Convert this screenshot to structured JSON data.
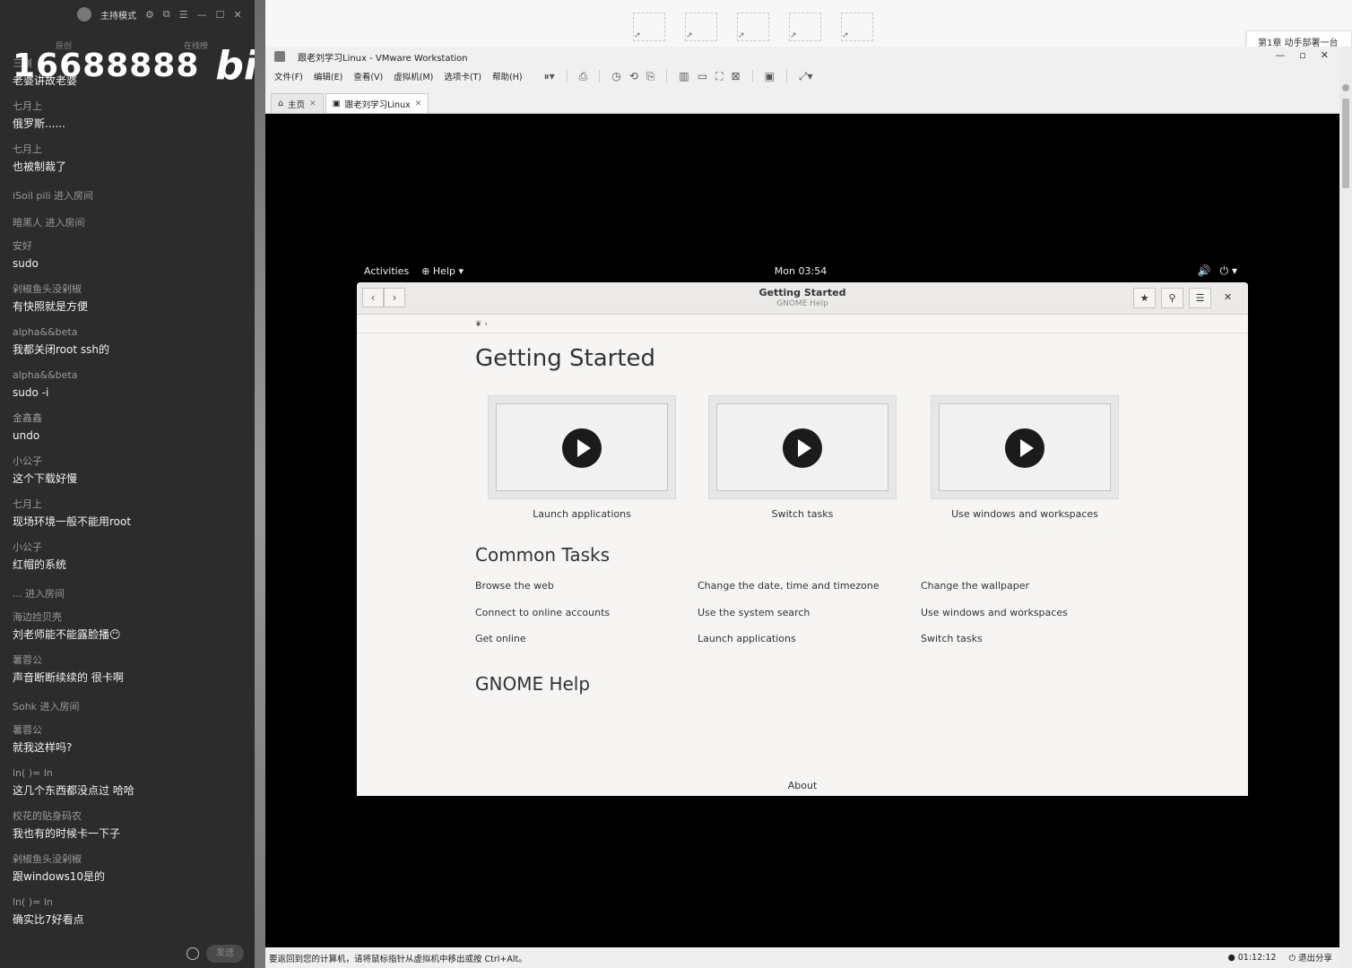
{
  "chat": {
    "header": {
      "mode": "主持模式"
    },
    "subheader": {
      "left": "原创",
      "right": "在线榜"
    },
    "brand": {
      "number": "16688888",
      "logo": "bili"
    },
    "messages": [
      {
        "user": "三崩",
        "text": "老婆讲故老婆"
      },
      {
        "user": "七月上",
        "text": "俄罗斯......"
      },
      {
        "user": "七月上",
        "text": "也被制裁了"
      },
      {
        "enter": "iSoil pili 进入房间"
      },
      {
        "enter": "暗黑人 进入房间"
      },
      {
        "user": "安好",
        "text": "sudo"
      },
      {
        "user": "剁椒鱼头没剁椒",
        "text": "有快照就是方便"
      },
      {
        "user": "alpha&&beta",
        "text": "我都关闭root ssh的"
      },
      {
        "user": "alpha&&beta",
        "text": "sudo -i"
      },
      {
        "user": "金鑫鑫",
        "text": "undo"
      },
      {
        "user": "小公子",
        "text": "这个下载好慢"
      },
      {
        "user": "七月上",
        "text": "现场环境一般不能用root"
      },
      {
        "user": "小公子",
        "text": "红帽的系统"
      },
      {
        "enter": "... 进入房间"
      },
      {
        "user": "海边捡贝壳",
        "text": "刘老师能不能露脸播😶"
      },
      {
        "user": "薯蓉公",
        "text": "声音断断续续的 很卡啊"
      },
      {
        "enter": "Sohk 进入房间"
      },
      {
        "user": "薯蓉公",
        "text": "就我这样吗?"
      },
      {
        "user": "ln( )= ln",
        "text": "这几个东西都没点过 哈哈"
      },
      {
        "user": "校花的贴身码农",
        "text": "我也有的时候卡一下子"
      },
      {
        "user": "剁椒鱼头没剁椒",
        "text": "跟windows10是的"
      },
      {
        "user": "ln( )= ln",
        "text": "确实比7好看点"
      }
    ],
    "send_label": "发送"
  },
  "notification": {
    "text": "第1章 动手部署一台"
  },
  "vmware": {
    "title": "跟老刘学习Linux - VMware Workstation",
    "menus": [
      "文件(F)",
      "编辑(E)",
      "查看(V)",
      "虚拟机(M)",
      "选项卡(T)",
      "帮助(H)"
    ],
    "tabs": [
      {
        "label": "主页"
      },
      {
        "label": "跟老刘学习Linux"
      }
    ],
    "status_text": "要返回到您的计算机，请将鼠标指针从虚拟机中移出或按 Ctrl+Alt。",
    "timer": "01:12:12",
    "exit_share": "退出分享"
  },
  "gnome": {
    "activities": "Activities",
    "app_menu": "Help",
    "clock": "Mon 03:54"
  },
  "help": {
    "title": "Getting Started",
    "subtitle": "GNOME Help",
    "heading": "Getting Started",
    "videos": [
      {
        "caption": "Launch applications"
      },
      {
        "caption": "Switch tasks"
      },
      {
        "caption": "Use windows and workspaces"
      }
    ],
    "common_heading": "Common Tasks",
    "tasks": [
      [
        "Browse the web",
        "Change the date, time and timezone",
        "Change the wallpaper"
      ],
      [
        "Connect to online accounts",
        "Use the system search",
        "Use windows and workspaces"
      ],
      [
        "Get online",
        "Launch applications",
        "Switch tasks"
      ]
    ],
    "gnome_help_heading": "GNOME Help",
    "about": "About"
  },
  "icons": {
    "star": "bookmark-star-icon",
    "search": "search-icon",
    "menu": "hamburger-menu-icon",
    "close": "close-icon"
  }
}
